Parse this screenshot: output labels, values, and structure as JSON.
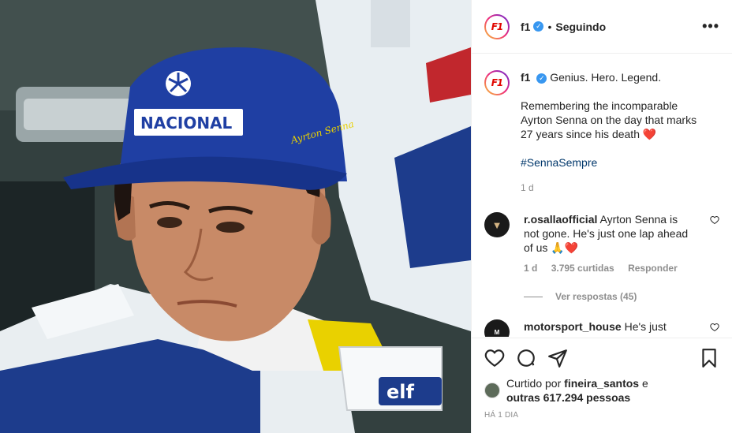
{
  "post": {
    "username": "f1",
    "following_label": "Seguindo",
    "more_label": "•••",
    "verified_glyph": "✓",
    "logo_text": "F1"
  },
  "caption": {
    "username": "f1",
    "line1": "Genius. Hero. Legend.",
    "body": "Remembering the incomparable Ayrton Senna on the day that marks 27 years since his death ❤️",
    "hashtag": "#SennaSempre",
    "age": "1 d"
  },
  "comments": [
    {
      "username": "r.osallaofficial",
      "text": "Ayrton Senna is not gone. He's just one lap ahead of us 🙏❤️",
      "age": "1 d",
      "likes": "3.795 curtidas",
      "reply": "Responder",
      "view_replies": "Ver respostas (45)"
    },
    {
      "username": "motorsport_house",
      "text": "He's just"
    }
  ],
  "photo": {
    "cap_text": "NACIONAL",
    "signature": "Ayrton Senna",
    "sponsor": "elf"
  },
  "likes": {
    "prefix": "Curtido por",
    "liker": "fineira_santos",
    "conj": "e",
    "others": "outras 617.294 pessoas"
  },
  "timestamp": "HÁ 1 DIA",
  "colors": {
    "verified": "#3897f0",
    "f1_red": "#e10600",
    "hashtag": "#00376b",
    "heart": "#ed4956"
  }
}
